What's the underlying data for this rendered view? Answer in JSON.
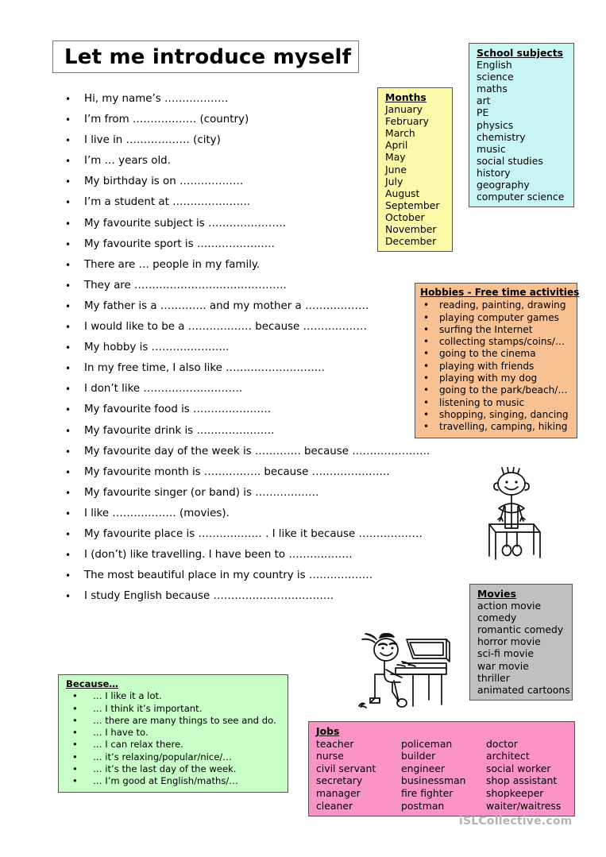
{
  "worksheet": {
    "title": "Let me introduce myself",
    "watermark": "iSLCollective.com"
  },
  "prompts": [
    "Hi, my name’s ………………",
    "I’m from ……………… (country)",
    "I live in ……………… (city)",
    "I’m  …  years old.",
    "My birthday is on ………………",
    "I’m a student at ………………….",
    "My favourite subject is ………………….",
    "My favourite sport is ………………….",
    "There are … people in my family.",
    "They are …………………………………….",
    "My father is a …………. and my mother a ………………",
    "I would like to be a ……………… because ………………",
    "My hobby is ………………….",
    "In my free time, I also like ……………………….",
    "I don’t like ……………………….",
    "My favourite food is ………………….",
    "My favourite drink is ………………….",
    "My favourite day of the week is …………. because ………………….",
    "My favourite month is ……………. because ………………….",
    "My favourite singer (or band) is ………………",
    "I like ……………… (movies).",
    "My favourite place is ………………  . I like it because ………………",
    "I (don’t) like travelling. I have been to ………………",
    "The most beautiful place in my country is ………………",
    "I study English because ……………………………."
  ],
  "boxes": {
    "school_subjects": {
      "title": "School subjects",
      "color": "#c9f4f4",
      "items": [
        "English",
        "science",
        "maths",
        "art",
        "PE",
        "physics",
        "chemistry",
        "music",
        "social studies",
        "history",
        "geography",
        "computer science"
      ]
    },
    "months": {
      "title": "Months",
      "color": "#fbf8a8",
      "items": [
        "January",
        "February",
        "March",
        "April",
        "May",
        "June",
        "July",
        "August",
        "September",
        "October",
        "November",
        "December"
      ]
    },
    "hobbies": {
      "title": "Hobbies - Free time activities",
      "color": "#f7c193",
      "items": [
        "reading, painting, drawing",
        "playing computer games",
        "surfing the Internet",
        "collecting stamps/coins/…",
        "going to the cinema",
        "playing with friends",
        "playing with my dog",
        "going to the park/beach/…",
        "listening to music",
        "shopping, singing, dancing",
        "travelling, camping, hiking"
      ]
    },
    "movies": {
      "title": "Movies",
      "color": "#c0c0c0",
      "items": [
        "action movie",
        "comedy",
        "romantic comedy",
        "horror movie",
        "sci-fi movie",
        "war movie",
        "thriller",
        "animated cartoons"
      ]
    },
    "because": {
      "title": "Because…",
      "color": "#c8fdc8",
      "items": [
        "… I like it a lot.",
        "… I think it’s important.",
        "… there are many things to see and do.",
        "… I have to.",
        "… I can relax there.",
        "… it’s relaxing/popular/nice/…",
        "… it’s the last day of the week.",
        "… I’m good at English/maths/…"
      ]
    },
    "jobs": {
      "title": "Jobs",
      "color": "#fa94c6",
      "items": [
        "teacher",
        "policeman",
        "doctor",
        "nurse",
        "builder",
        "architect",
        "civil servant",
        "engineer",
        "social worker",
        "secretary",
        "businessman",
        "shop assistant",
        "manager",
        "fire fighter",
        "shopkeeper",
        "cleaner",
        "postman",
        "waiter/waitress"
      ]
    }
  },
  "illustrations": [
    {
      "name": "boy-reading-book-at-desk"
    },
    {
      "name": "girl-at-computer-desk"
    }
  ]
}
